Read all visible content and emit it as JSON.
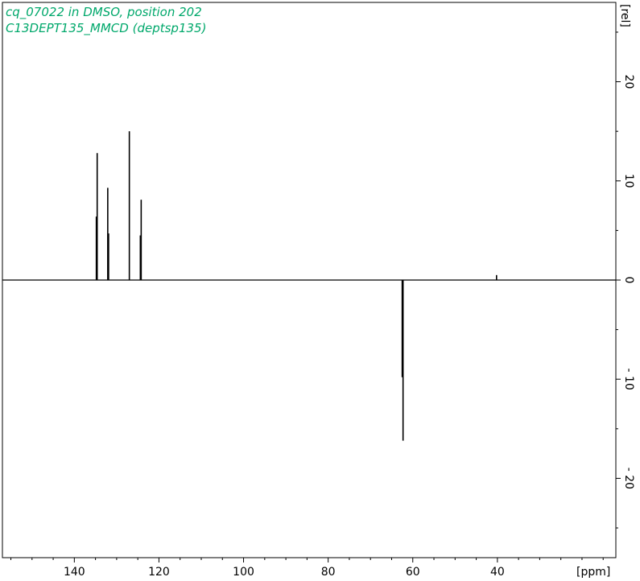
{
  "header": {
    "line1": "cq_07022 in DMSO, position 202",
    "line2": "C13DEPT135_MMCD (deptsp135)",
    "color": "#00a86b"
  },
  "chart_data": {
    "type": "line",
    "title": "cq_07022 in DMSO, position 202",
    "subtitle": "C13DEPT135_MMCD (deptsp135)",
    "xlabel": "[ppm]",
    "ylabel": "[rel]",
    "xlim": [
      157,
      12
    ],
    "ylim": [
      -28,
      28
    ],
    "x_reversed": true,
    "x_ticks": [
      140,
      120,
      100,
      80,
      60,
      40
    ],
    "x_tick_labels": [
      "140",
      "120",
      "100",
      "80",
      "60",
      "40"
    ],
    "y_ticks": [
      20,
      10,
      0,
      -10,
      -20
    ],
    "y_tick_labels": [
      "20",
      "10",
      "0",
      "- 10",
      "- 20"
    ],
    "grid": false,
    "baseline": 0,
    "line_color": "#000000",
    "series": [
      {
        "peaks": [
          {
            "x": 134.6,
            "y": 12.8
          },
          {
            "x": 134.8,
            "y": 6.4
          },
          {
            "x": 132.1,
            "y": 9.3
          },
          {
            "x": 131.9,
            "y": 4.7
          },
          {
            "x": 127.0,
            "y": 15.0
          },
          {
            "x": 124.2,
            "y": 8.1
          },
          {
            "x": 124.4,
            "y": 4.5
          },
          {
            "x": 62.3,
            "y": -16.2
          },
          {
            "x": 62.5,
            "y": -9.8
          },
          {
            "x": 40.2,
            "y": 0.5
          }
        ]
      }
    ]
  }
}
